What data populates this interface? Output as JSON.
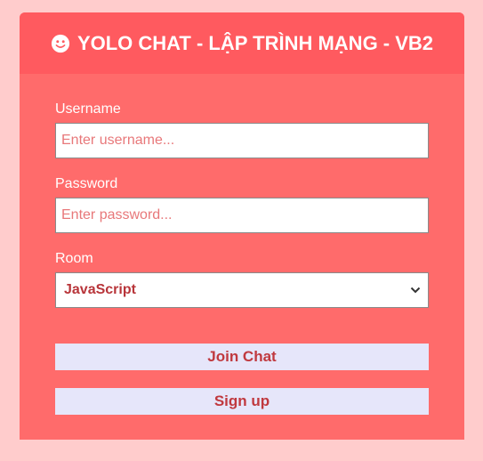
{
  "header": {
    "icon": "smile-icon",
    "title": "YOLO CHAT - LẬP TRÌNH MẠNG - VB2"
  },
  "form": {
    "username": {
      "label": "Username",
      "placeholder": "Enter username...",
      "value": ""
    },
    "password": {
      "label": "Password",
      "placeholder": "Enter password...",
      "value": ""
    },
    "room": {
      "label": "Room",
      "selected": "JavaScript"
    },
    "join_label": "Join Chat",
    "signup_label": "Sign up"
  },
  "colors": {
    "page_background": "#ffcccc",
    "card_background": "#ff6b6b",
    "header_background": "#ff5a5f",
    "button_background": "#e6e6fa",
    "button_text": "#c0393f"
  }
}
